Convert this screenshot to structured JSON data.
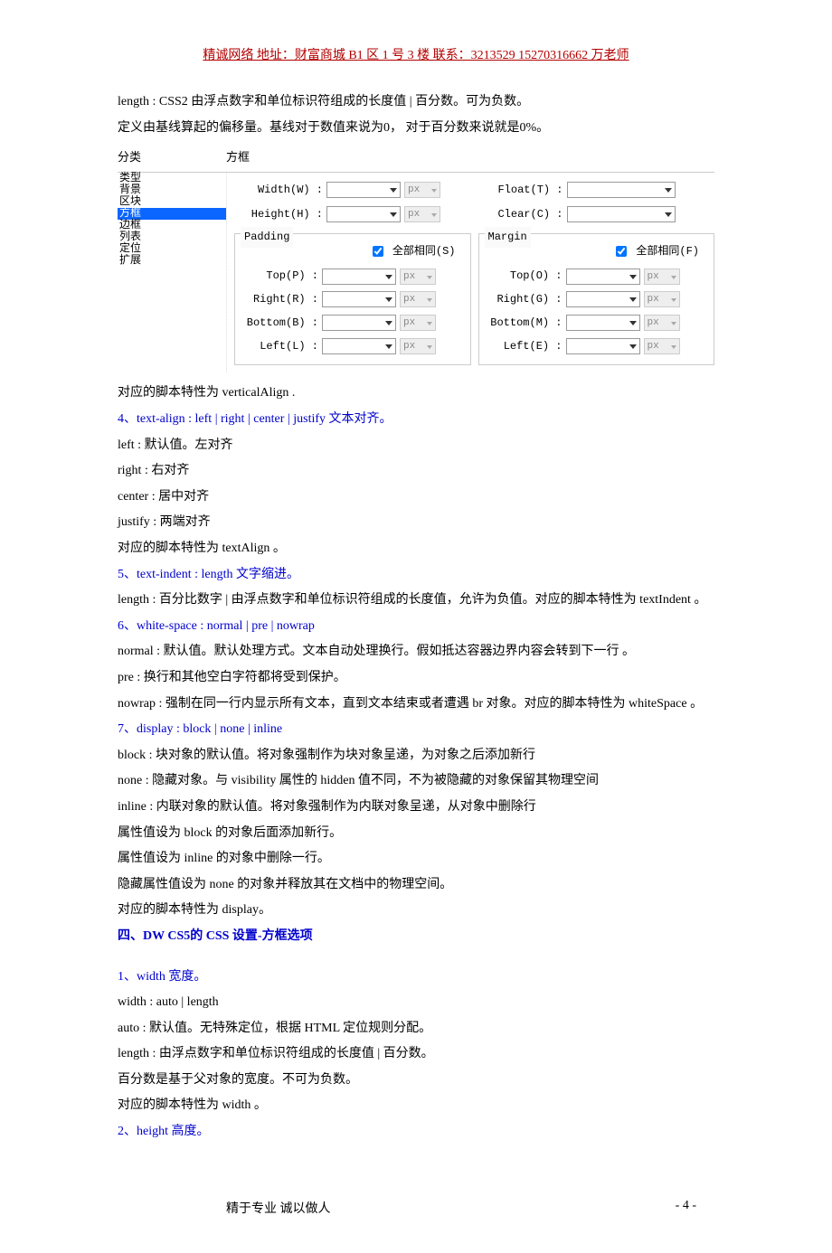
{
  "header": "精诚网络  地址：财富商城 B1 区 1 号 3 楼  联系：3213529 15270316662  万老师",
  "para1": "length : CSS2  由浮点数字和单位标识符组成的长度值 | 百分数。可为负数。",
  "para2": "  定义由基线算起的偏移量。基线对于数值来说为0，  对于百分数来说就是0%。",
  "cat_label": "分类",
  "panel_label": "方框",
  "categories": [
    "类型",
    "背景",
    "区块",
    "方框",
    "边框",
    "列表",
    "定位",
    "扩展"
  ],
  "form": {
    "width_label": "Width(W) :",
    "height_label": "Height(H) :",
    "float_label": "Float(T) :",
    "clear_label": "Clear(C) :",
    "padding_title": "Padding",
    "margin_title": "Margin",
    "same_s": "全部相同(S)",
    "same_f": "全部相同(F)",
    "p_top": "Top(P) :",
    "p_right": "Right(R) :",
    "p_bottom": "Bottom(B) :",
    "p_left": "Left(L) :",
    "m_top": "Top(O) :",
    "m_right": "Right(G) :",
    "m_bottom": "Bottom(M) :",
    "m_left": "Left(E) :",
    "unit": "px"
  },
  "l_corr": "  对应的脚本特性为  verticalAlign .",
  "h4": "4、text-align : left | right | center | justify  文本对齐。",
  "h4_left": "left :    默认值。左对齐",
  "h4_right": "right :    右对齐",
  "h4_center": "center :    居中对齐",
  "h4_justify": "justify :    两端对齐",
  "h4_corr": "  对应的脚本特性为 textAlign 。",
  "h5": "5、text-indent : length  文字缩进。",
  "h5_desc": "length :    百分比数字 | 由浮点数字和单位标识符组成的长度值，允许为负值。对应的脚本特性为 textIndent 。",
  "h6": "6、white-space : normal | pre | nowrap",
  "h6_normal": "  normal :    默认值。默认处理方式。文本自动处理换行。假如抵达容器边界内容会转到下一行 。",
  "h6_pre": "pre :    换行和其他空白字符都将受到保护。",
  "h6_nowrap": "nowrap :    强制在同一行内显示所有文本，直到文本结束或者遭遇  br 对象。对应的脚本特性为 whiteSpace 。",
  "h7": "7、display : block | none | inline",
  "h7_block": "  block :    块对象的默认值。将对象强制作为块对象呈递，为对象之后添加新行",
  "h7_none": "none :    隐藏对象。与  visibility  属性的 hidden 值不同，不为被隐藏的对象保留其物理空间",
  "h7_inline": "inline :    内联对象的默认值。将对象强制作为内联对象呈递，从对象中删除行",
  "h7_a": "属性值设为  block  的对象后面添加新行。",
  "h7_b": "  属性值设为  inline  的对象中删除一行。",
  "h7_c": "  隐藏属性值设为  none  的对象并释放其在文档中的物理空间。",
  "h7_d": "  对应的脚本特性为 display。",
  "section4": "四、DW CS5的 CSS 设置-方框选项",
  "w1": "1、width  宽度。",
  "w1_a": "width : auto | length",
  "w1_b": "  auto :    默认值。无特殊定位，根据 HTML 定位规则分配。",
  "w1_c": "length :    由浮点数字和单位标识符组成的长度值 | 百分数。",
  "w1_d": "百分数是基于父对象的宽度。不可为负数。",
  "w1_e": "  对应的脚本特性为  width 。",
  "w2": "2、height  高度。",
  "footer_left": "精于专业  诚以做人",
  "footer_right": "- 4 -"
}
